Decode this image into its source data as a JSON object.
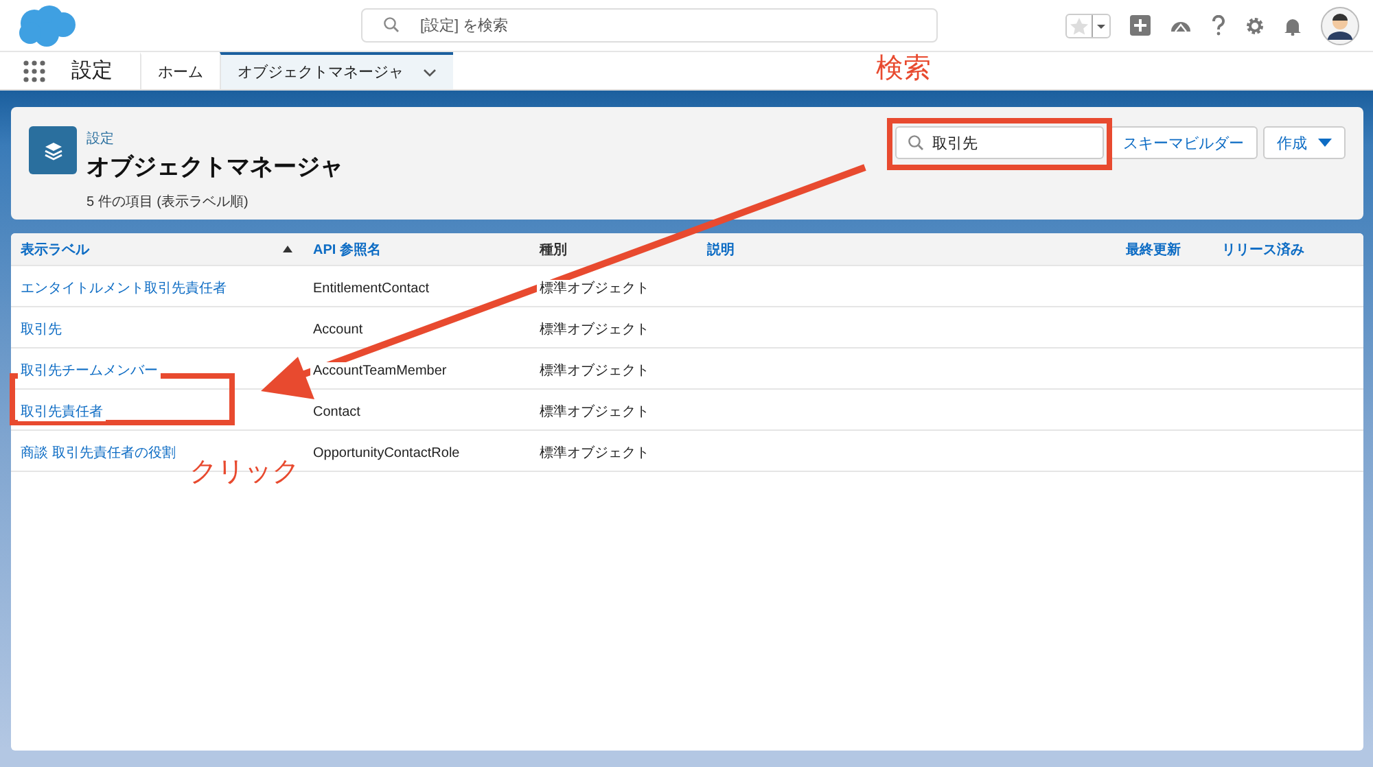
{
  "header": {
    "search": {
      "placeholder": "[設定] を検索"
    }
  },
  "nav": {
    "app_name": "設定",
    "tabs": [
      {
        "label": "ホーム",
        "selected": false,
        "menu": false
      },
      {
        "label": "オブジェクトマネージャ",
        "selected": true,
        "menu": true
      }
    ]
  },
  "page_header": {
    "breadcrumb": "設定",
    "title": "オブジェクトマネージャ",
    "summary": "5 件の項目 (表示ラベル順)",
    "search": {
      "value": "取引先"
    },
    "buttons": [
      {
        "label": "スキーマビルダー",
        "kind": "plain"
      },
      {
        "label": "作成",
        "kind": "dropdown"
      }
    ]
  },
  "table": {
    "columns": [
      {
        "label": "表示ラベル",
        "sorted": true
      },
      {
        "label": "API 参照名",
        "sorted": false
      },
      {
        "label": "種別",
        "sorted": false
      },
      {
        "label": "説明",
        "sorted": false
      },
      {
        "label": "最終更新",
        "sorted": false
      },
      {
        "label": "リリース済み",
        "sorted": false
      }
    ],
    "rows": [
      {
        "label": "エンタイトルメント取引先責任者",
        "api_name": "EntitlementContact",
        "type": "標準オブジェクト"
      },
      {
        "label": "取引先",
        "api_name": "Account",
        "type": "標準オブジェクト"
      },
      {
        "label": "取引先チームメンバー",
        "api_name": "AccountTeamMember",
        "type": "標準オブジェクト"
      },
      {
        "label": "取引先責任者",
        "api_name": "Contact",
        "type": "標準オブジェクト"
      },
      {
        "label": "商談 取引先責任者の役割",
        "api_name": "OpportunityContactRole",
        "type": "標準オブジェクト"
      }
    ]
  },
  "annotations": {
    "search_label": "検索",
    "click_label": "クリック"
  }
}
